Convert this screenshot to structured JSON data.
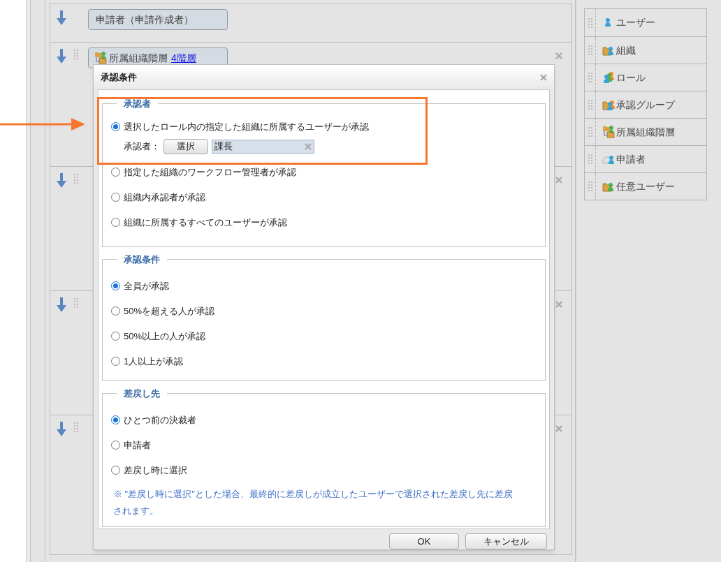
{
  "flow_steps": [
    {
      "kind": "fixed",
      "label": "申請者（申請作成者）"
    },
    {
      "kind": "hierarchy",
      "label": "所属組織階層",
      "link": "4階層"
    },
    {
      "kind": "step"
    },
    {
      "kind": "step"
    },
    {
      "kind": "step"
    }
  ],
  "palette": {
    "items": [
      {
        "kind": "user",
        "label": "ユーザー"
      },
      {
        "kind": "org",
        "label": "組織"
      },
      {
        "kind": "role",
        "label": "ロール"
      },
      {
        "kind": "group",
        "label": "承認グループ"
      },
      {
        "kind": "hierarchy",
        "label": "所属組織階層"
      },
      {
        "kind": "applicant",
        "label": "申請者"
      },
      {
        "kind": "any_user",
        "label": "任意ユーザー"
      }
    ]
  },
  "dialog": {
    "title": "承認条件",
    "sections": [
      {
        "legend": "承認者",
        "options": [
          {
            "label": "選択したロール内の指定した組織に所属するユーザーが承認",
            "selected": true,
            "approver": {
              "label": "承認者：",
              "button": "選択",
              "value": "課長"
            }
          },
          {
            "label": "指定した組織のワークフロー管理者が承認",
            "selected": false
          },
          {
            "label": "組織内承認者が承認",
            "selected": false
          },
          {
            "label": "組織に所属するすべてのユーザーが承認",
            "selected": false
          }
        ]
      },
      {
        "legend": "承認条件",
        "options": [
          {
            "label": "全員が承認",
            "selected": true
          },
          {
            "label": "50%を超える人が承認",
            "selected": false
          },
          {
            "label": "50%以上の人が承認",
            "selected": false
          },
          {
            "label": "1人以上が承認",
            "selected": false
          }
        ]
      },
      {
        "legend": "差戻し先",
        "options": [
          {
            "label": "ひとつ前の決裁者",
            "selected": true
          },
          {
            "label": "申請者",
            "selected": false
          },
          {
            "label": "差戻し時に選択",
            "selected": false
          }
        ],
        "note": "※ \"差戻し時に選択\"とした場合、最終的に差戻しが成立したユーザーで選択された差戻し先に差戻されます。"
      }
    ],
    "buttons": [
      "OK",
      "キャンセル"
    ]
  }
}
